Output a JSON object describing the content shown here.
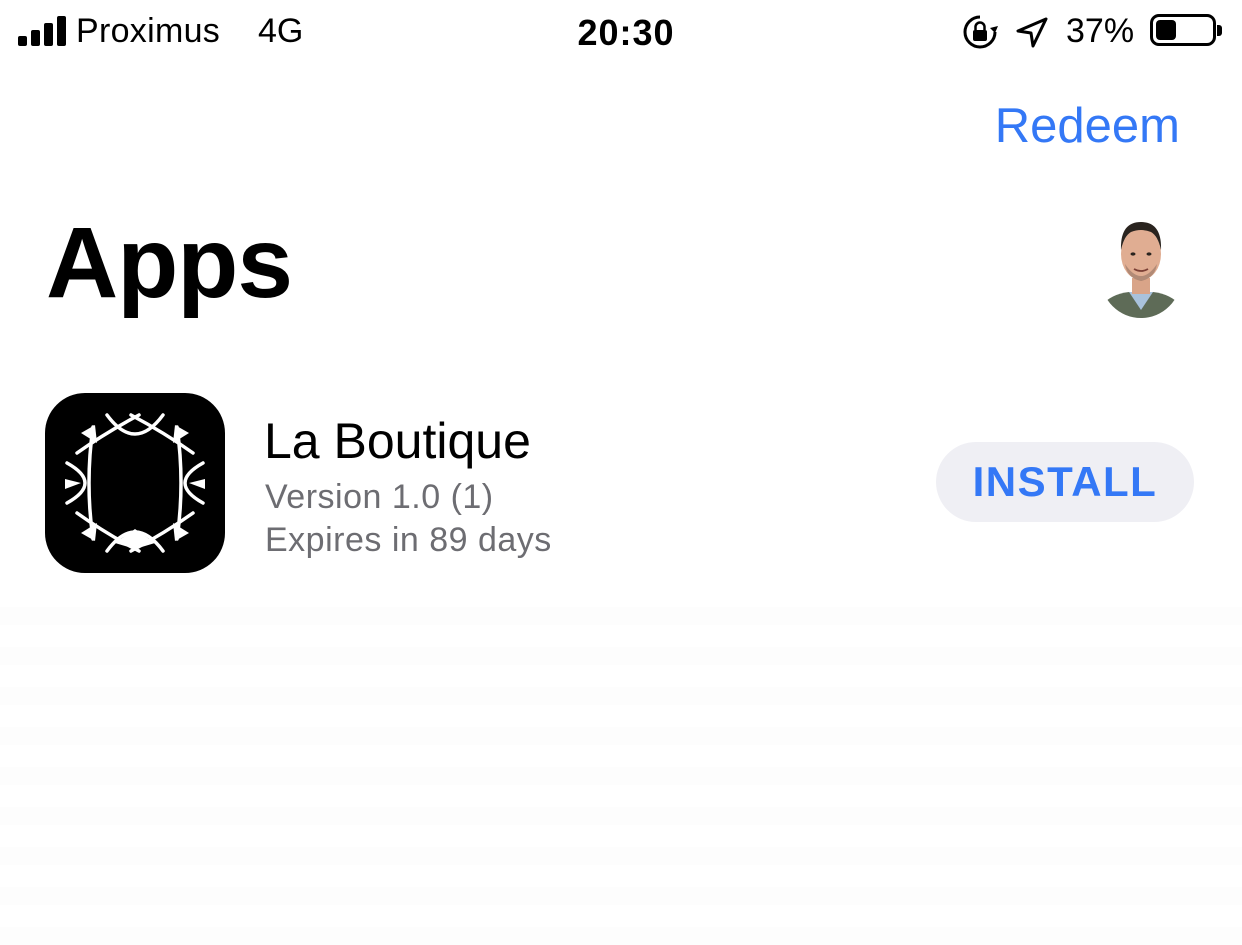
{
  "status_bar": {
    "carrier": "Proximus",
    "network": "4G",
    "time": "20:30",
    "battery_percent_label": "37%",
    "battery_level": 0.37,
    "signal_bars": 4,
    "icons": [
      "signal-icon",
      "orientation-lock-icon",
      "location-arrow-icon",
      "battery-icon"
    ]
  },
  "nav": {
    "redeem_label": "Redeem"
  },
  "page": {
    "title": "Apps"
  },
  "apps": [
    {
      "name": "La Boutique",
      "version": "Version 1.0 (1)",
      "expiry": "Expires in 89 days",
      "action_label": "INSTALL",
      "icon": "la-boutique-app-icon"
    }
  ],
  "colors": {
    "accent": "#3478f6",
    "secondary_text": "#6d6d72",
    "button_background": "#efeff4"
  }
}
